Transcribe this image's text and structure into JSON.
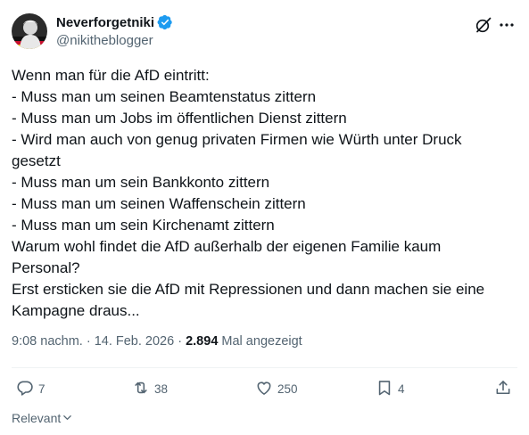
{
  "author": {
    "display_name": "Neverforgetniki",
    "handle": "@nikitheblogger",
    "verified": true,
    "verified_color": "#1d9bf0"
  },
  "tweet": {
    "lines": [
      "Wenn man für die AfD eintritt:",
      "- Muss man um seinen Beamtenstatus zittern",
      "- Muss man um Jobs im öffentlichen Dienst zittern",
      "- Wird man auch von genug privaten Firmen wie Würth unter Druck",
      "gesetzt",
      "- Muss man um sein Bankkonto zittern",
      "- Muss man um seinen Waffenschein zittern",
      "- Muss man um sein Kirchenamt zittern",
      "Warum wohl findet die AfD außerhalb der eigenen Familie kaum",
      "Personal?",
      "Erst ersticken sie die AfD mit Repressionen und dann machen sie eine",
      "Kampagne draus..."
    ]
  },
  "meta": {
    "time": "9:08 nachm.",
    "sep1": " · ",
    "date": "14. Feb. 2026",
    "sep2": " · ",
    "views": "2.894",
    "views_label": " Mal angezeigt"
  },
  "actions": {
    "replies": "7",
    "reposts": "38",
    "likes": "250",
    "bookmarks": "4"
  },
  "footer": {
    "sort_label": "Relevant"
  },
  "icons": {
    "verified": "verified-badge-icon",
    "grok": "grok-icon",
    "more": "more-options-icon",
    "reply": "reply-icon",
    "repost": "repost-icon",
    "like": "heart-icon",
    "bookmark": "bookmark-icon",
    "share": "share-icon",
    "sort": "chevron-down-icon"
  },
  "colors": {
    "text": "#0f1419",
    "secondary": "#536471",
    "divider": "#eff3f4"
  }
}
